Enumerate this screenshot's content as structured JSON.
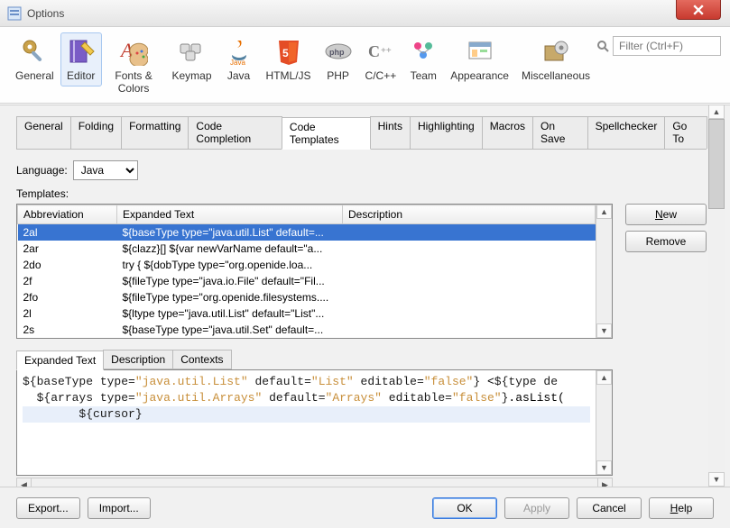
{
  "window": {
    "title": "Options"
  },
  "toolbar": {
    "items": [
      {
        "label": "General"
      },
      {
        "label": "Editor"
      },
      {
        "label": "Fonts & Colors"
      },
      {
        "label": "Keymap"
      },
      {
        "label": "Java"
      },
      {
        "label": "HTML/JS"
      },
      {
        "label": "PHP"
      },
      {
        "label": "C/C++"
      },
      {
        "label": "Team"
      },
      {
        "label": "Appearance"
      },
      {
        "label": "Miscellaneous"
      }
    ],
    "search_placeholder": "Filter (Ctrl+F)"
  },
  "subtabs": [
    "General",
    "Folding",
    "Formatting",
    "Code Completion",
    "Code Templates",
    "Hints",
    "Highlighting",
    "Macros",
    "On Save",
    "Spellchecker",
    "Go To"
  ],
  "language": {
    "label": "Language:",
    "value": "Java"
  },
  "templates_label": "Templates:",
  "columns": [
    "Abbreviation",
    "Expanded Text",
    "Description"
  ],
  "rows": [
    {
      "abbr": "2al",
      "exp": "${baseType type=\"java.util.List\" default=...",
      "desc": ""
    },
    {
      "abbr": "2ar",
      "exp": "${clazz}[] ${var newVarName default=\"a...",
      "desc": ""
    },
    {
      "abbr": "2do",
      "exp": "try {    ${dobType type=\"org.openide.loa...",
      "desc": ""
    },
    {
      "abbr": "2f",
      "exp": "${fileType type=\"java.io.File\" default=\"Fil...",
      "desc": ""
    },
    {
      "abbr": "2fo",
      "exp": "${fileType type=\"org.openide.filesystems....",
      "desc": ""
    },
    {
      "abbr": "2l",
      "exp": "${ltype type=\"java.util.List\" default=\"List\"...",
      "desc": ""
    },
    {
      "abbr": "2s",
      "exp": "${baseType type=\"java.util.Set\" default=...",
      "desc": ""
    }
  ],
  "detail_tabs": [
    "Expanded Text",
    "Description",
    "Contexts"
  ],
  "editor": {
    "line1": "${baseType type=\"java.util.List\" default=\"List\" editable=\"false\"} <${type de",
    "line2": "  ${arrays type=\"java.util.Arrays\" default=\"Arrays\" editable=\"false\"}.asList(",
    "line3": "        ${cursor}"
  },
  "buttons": {
    "new": "New",
    "remove": "Remove",
    "export": "Export...",
    "import": "Import...",
    "ok": "OK",
    "apply": "Apply",
    "cancel": "Cancel",
    "help": "Help"
  }
}
